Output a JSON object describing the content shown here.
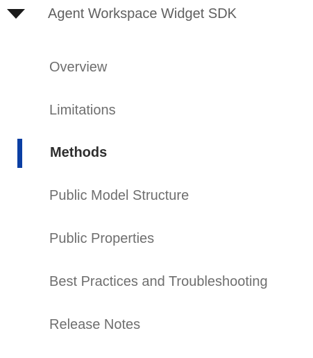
{
  "section": {
    "title": "Agent Workspace Widget SDK",
    "expanded_icon": "caret-down-icon"
  },
  "items": [
    {
      "label": "Overview"
    },
    {
      "label": "Limitations"
    },
    {
      "label": "Methods",
      "active": true
    },
    {
      "label": "Public Model Structure"
    },
    {
      "label": "Public Properties"
    },
    {
      "label": "Best Practices and Troubleshooting"
    },
    {
      "label": "Release Notes"
    }
  ],
  "colors": {
    "active_indicator": "#0a3ea3",
    "text": "#6e6e6e",
    "active_text": "#2e2e2e"
  }
}
